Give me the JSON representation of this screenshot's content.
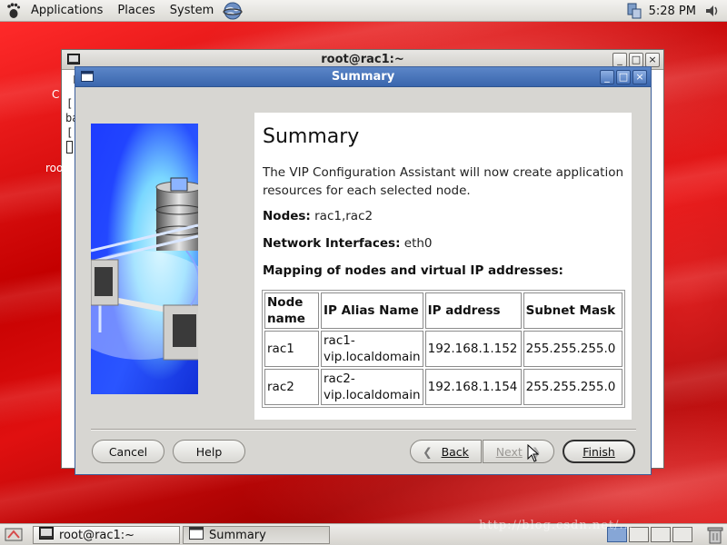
{
  "top_panel": {
    "menus": [
      "Applications",
      "Places",
      "System"
    ],
    "clock": "5:28 PM"
  },
  "terminal": {
    "title": "root@rac1:~",
    "buttons": [
      "_",
      "□",
      "×"
    ],
    "visible_fragments": [
      "F",
      "[",
      "ba",
      "[",
      "C",
      "roo"
    ]
  },
  "dialog": {
    "title": "Summary",
    "heading": "Summary",
    "description": "The VIP Configuration Assistant will now create application resources for each selected node.",
    "nodes_label": "Nodes:",
    "nodes_value": "rac1,rac2",
    "interfaces_label": "Network Interfaces:",
    "interfaces_value": "eth0",
    "mapping_heading": "Mapping of nodes and virtual IP addresses:",
    "table": {
      "headers": [
        "Node name",
        "IP Alias Name",
        "IP address",
        "Subnet Mask"
      ],
      "rows": [
        [
          "rac1",
          "rac1-vip.localdomain",
          "192.168.1.152",
          "255.255.255.0"
        ],
        [
          "rac2",
          "rac2-vip.localdomain",
          "192.168.1.154",
          "255.255.255.0"
        ]
      ]
    },
    "buttons": {
      "cancel": "Cancel",
      "help": "Help",
      "back": "Back",
      "next": "Next",
      "finish": "Finish"
    }
  },
  "taskbar": {
    "items": [
      "root@rac1:~",
      "Summary"
    ]
  },
  "watermark": "http://blog.csdn.net/..."
}
